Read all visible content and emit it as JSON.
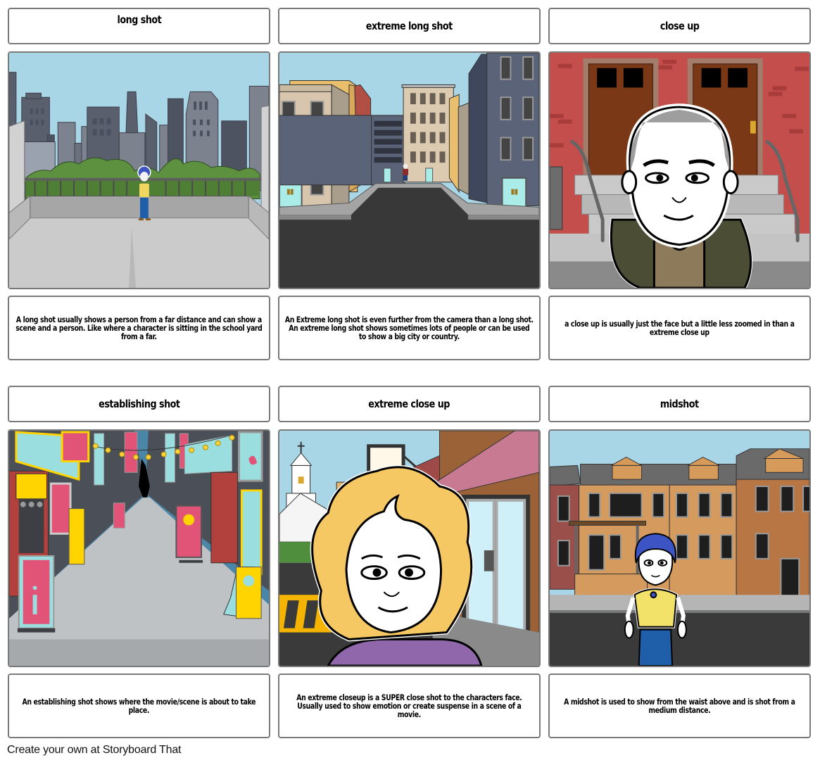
{
  "storyboard": {
    "panels": [
      {
        "title": "long shot",
        "scene": "rooftop-city-skyline-with-person",
        "description": "A long shot usually shows a person from a far distance and can show a scene and a person. Like where a character is sitting in the school yard from a far."
      },
      {
        "title": "extreme long shot",
        "scene": "city-street-with-tiny-person",
        "description": "An Extreme long shot is even further from the camera than a long shot. An extreme long shot shows sometimes lots of people or can be used to show a big city or country."
      },
      {
        "title": "close up",
        "scene": "man-face-in-front-of-brownstone-doors",
        "description": "a close up is usually just the face but a little less zoomed in than a extreme close up"
      },
      {
        "title": "establishing shot",
        "scene": "neon-sign-alley",
        "description": "An establishing shot shows where the movie/scene is about to take place."
      },
      {
        "title": "extreme close up",
        "scene": "blonde-woman-face-on-street",
        "description": "An extreme closeup is a SUPER close shot to the characters face. Usually used to show emotion or create suspense in a scene of a movie."
      },
      {
        "title": "midshot",
        "scene": "woman-in-turban-waist-up-row-houses",
        "description": "A midshot is used to show from the waist above and is shot from a medium distance."
      }
    ]
  },
  "footer": {
    "label": "Create your own at Storyboard That"
  },
  "colors": {
    "border": "#7a7a7a",
    "sky": "#a8d6e6"
  }
}
